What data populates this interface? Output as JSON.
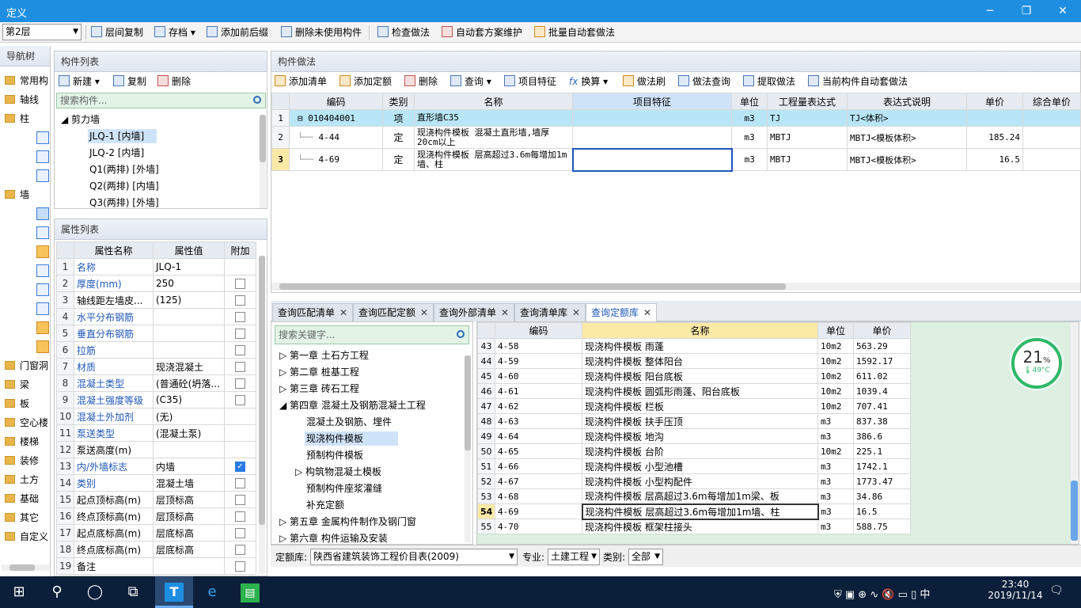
{
  "window": {
    "title": "定义",
    "min": "─",
    "max": "❐",
    "close": "✕"
  },
  "toolbar": {
    "floor": "第2层",
    "items": [
      "层间复制",
      "存档",
      "添加前后缀",
      "删除未使用构件",
      "检查做法",
      "自动套方案维护",
      "批量自动套做法"
    ]
  },
  "nav": {
    "title": "导航树",
    "items": [
      "常用构",
      "轴线",
      "柱",
      "墙",
      "门窗洞",
      "梁",
      "板",
      "空心楼",
      "楼梯",
      "装修",
      "土方",
      "基础",
      "其它",
      "自定义"
    ]
  },
  "components": {
    "title": "构件列表",
    "new": "新建",
    "copy": "复制",
    "delete": "删除",
    "search_placeholder": "搜索构件...",
    "group": "剪力墙",
    "items": [
      "JLQ-1 [内墙]",
      "JLQ-2 [内墙]",
      "Q1(两排) [外墙]",
      "Q2(两排) [内墙]",
      "Q3(两排) [外墙]"
    ]
  },
  "properties": {
    "title": "属性列表",
    "headers": [
      "属性名称",
      "属性值",
      "附加"
    ],
    "rows": [
      {
        "n": "1",
        "name": "名称",
        "value": "JLQ-1",
        "blue": true,
        "cb": ""
      },
      {
        "n": "2",
        "name": "厚度(mm)",
        "value": "250",
        "blue": true,
        "cb": "off"
      },
      {
        "n": "3",
        "name": "轴线距左墙皮...",
        "value": "(125)",
        "blue": false,
        "cb": "off"
      },
      {
        "n": "4",
        "name": "水平分布钢筋",
        "value": "",
        "blue": true,
        "cb": "off"
      },
      {
        "n": "5",
        "name": "垂直分布钢筋",
        "value": "",
        "blue": true,
        "cb": "off"
      },
      {
        "n": "6",
        "name": "拉筋",
        "value": "",
        "blue": true,
        "cb": "off"
      },
      {
        "n": "7",
        "name": "材质",
        "value": "现浇混凝土",
        "blue": true,
        "cb": "off"
      },
      {
        "n": "8",
        "name": "混凝土类型",
        "value": "(普通砼(坍落...",
        "blue": true,
        "cb": "off"
      },
      {
        "n": "9",
        "name": "混凝土强度等级",
        "value": "(C35)",
        "blue": true,
        "cb": "off"
      },
      {
        "n": "10",
        "name": "混凝土外加剂",
        "value": "(无)",
        "blue": true,
        "cb": ""
      },
      {
        "n": "11",
        "name": "泵送类型",
        "value": "(混凝土泵)",
        "blue": true,
        "cb": ""
      },
      {
        "n": "12",
        "name": "泵送高度(m)",
        "value": "",
        "blue": false,
        "cb": ""
      },
      {
        "n": "13",
        "name": "内/外墙标志",
        "value": "内墙",
        "blue": true,
        "cb": "on"
      },
      {
        "n": "14",
        "name": "类别",
        "value": "混凝土墙",
        "blue": true,
        "cb": "off"
      },
      {
        "n": "15",
        "name": "起点顶标高(m)",
        "value": "层顶标高",
        "blue": false,
        "cb": "off"
      },
      {
        "n": "16",
        "name": "终点顶标高(m)",
        "value": "层顶标高",
        "blue": false,
        "cb": "off"
      },
      {
        "n": "17",
        "name": "起点底标高(m)",
        "value": "层底标高",
        "blue": false,
        "cb": "off"
      },
      {
        "n": "18",
        "name": "终点底标高(m)",
        "value": "层底标高",
        "blue": false,
        "cb": "off"
      },
      {
        "n": "19",
        "name": "备注",
        "value": "",
        "blue": false,
        "cb": "off"
      }
    ]
  },
  "method": {
    "title": "构件做法",
    "buttons": [
      "添加清单",
      "添加定额",
      "删除",
      "查询",
      "项目特征",
      "换算",
      "做法刷",
      "做法查询",
      "提取做法",
      "当前构件自动套做法"
    ],
    "headers": [
      "编码",
      "类别",
      "名称",
      "项目特征",
      "单位",
      "工程量表达式",
      "表达式说明",
      "单价",
      "综合单价"
    ],
    "rows": [
      {
        "n": "1",
        "code": "010404001",
        "type": "项",
        "name": "直形墙C35",
        "feature": "",
        "unit": "m3",
        "expr": "TJ",
        "desc": "TJ<体积>",
        "price": "",
        "total": ""
      },
      {
        "n": "2",
        "code": "4-44",
        "type": "定",
        "name": "现浇构件模板 混凝土直形墙,墙厚20cm以上",
        "feature": "",
        "unit": "m3",
        "expr": "MBTJ",
        "desc": "MBTJ<模板体积>",
        "price": "185.24",
        "total": ""
      },
      {
        "n": "3",
        "code": "4-69",
        "type": "定",
        "name": "现浇构件模板 层高超过3.6m每增加1m墙、柱",
        "feature": "",
        "unit": "m3",
        "expr": "MBTJ",
        "desc": "MBTJ<模板体积>",
        "price": "16.5",
        "total": ""
      }
    ]
  },
  "tabs": [
    "查询匹配清单",
    "查询匹配定额",
    "查询外部清单",
    "查询清单库",
    "查询定额库"
  ],
  "lib": {
    "search_placeholder": "搜索关键字...",
    "tree": [
      "第一章 土石方工程",
      "第二章 桩基工程",
      "第三章 砖石工程",
      "第四章 混凝土及钢筋混凝土工程",
      "混凝土及钢筋、埋件",
      "现浇构件模板",
      "预制构件模板",
      "构筑物混凝土模板",
      "预制构件座浆灌缝",
      "补充定额",
      "第五章 金属构件制作及钢门窗",
      "第六章 构件运输及安装"
    ],
    "headers": [
      "编码",
      "名称",
      "单位",
      "单价"
    ],
    "rows": [
      {
        "n": "43",
        "code": "4-58",
        "name": "现浇构件模板 雨蓬",
        "unit": "10m2",
        "price": "563.29"
      },
      {
        "n": "44",
        "code": "4-59",
        "name": "现浇构件模板 整体阳台",
        "unit": "10m2",
        "price": "1592.17"
      },
      {
        "n": "45",
        "code": "4-60",
        "name": "现浇构件模板 阳台底板",
        "unit": "10m2",
        "price": "611.02"
      },
      {
        "n": "46",
        "code": "4-61",
        "name": "现浇构件模板 圆弧形雨蓬、阳台底板",
        "unit": "10m2",
        "price": "1039.4"
      },
      {
        "n": "47",
        "code": "4-62",
        "name": "现浇构件模板 栏板",
        "unit": "10m2",
        "price": "707.41"
      },
      {
        "n": "48",
        "code": "4-63",
        "name": "现浇构件模板 扶手压顶",
        "unit": "m3",
        "price": "837.38"
      },
      {
        "n": "49",
        "code": "4-64",
        "name": "现浇构件模板 地沟",
        "unit": "m3",
        "price": "386.6"
      },
      {
        "n": "50",
        "code": "4-65",
        "name": "现浇构件模板 台阶",
        "unit": "10m2",
        "price": "225.1"
      },
      {
        "n": "51",
        "code": "4-66",
        "name": "现浇构件模板 小型池槽",
        "unit": "m3",
        "price": "1742.1"
      },
      {
        "n": "52",
        "code": "4-67",
        "name": "现浇构件模板 小型构配件",
        "unit": "m3",
        "price": "1773.47"
      },
      {
        "n": "53",
        "code": "4-68",
        "name": "现浇构件模板 层高超过3.6m每增加1m梁、板",
        "unit": "m3",
        "price": "34.86"
      },
      {
        "n": "54",
        "code": "4-69",
        "name": "现浇构件模板 层高超过3.6m每增加1m墙、柱",
        "unit": "m3",
        "price": "16.5"
      },
      {
        "n": "55",
        "code": "4-70",
        "name": "现浇构件模板 框架柱接头",
        "unit": "m3",
        "price": "588.75"
      }
    ]
  },
  "bottom": {
    "lib_label": "定额库:",
    "lib_value": "陕西省建筑装饰工程价目表(2009)",
    "spec_label": "专业:",
    "spec_value": "土建工程",
    "cat_label": "类别:",
    "cat_value": "全部"
  },
  "gauge": {
    "percent": "21",
    "unit": "%",
    "temp": "49°C"
  },
  "clock": {
    "time": "23:40",
    "date": "2019/11/14"
  },
  "colors": {
    "titlebar": "#1e8ee0",
    "selected_row": "#b8e6f6",
    "taskbar": "#0c1f3a"
  }
}
